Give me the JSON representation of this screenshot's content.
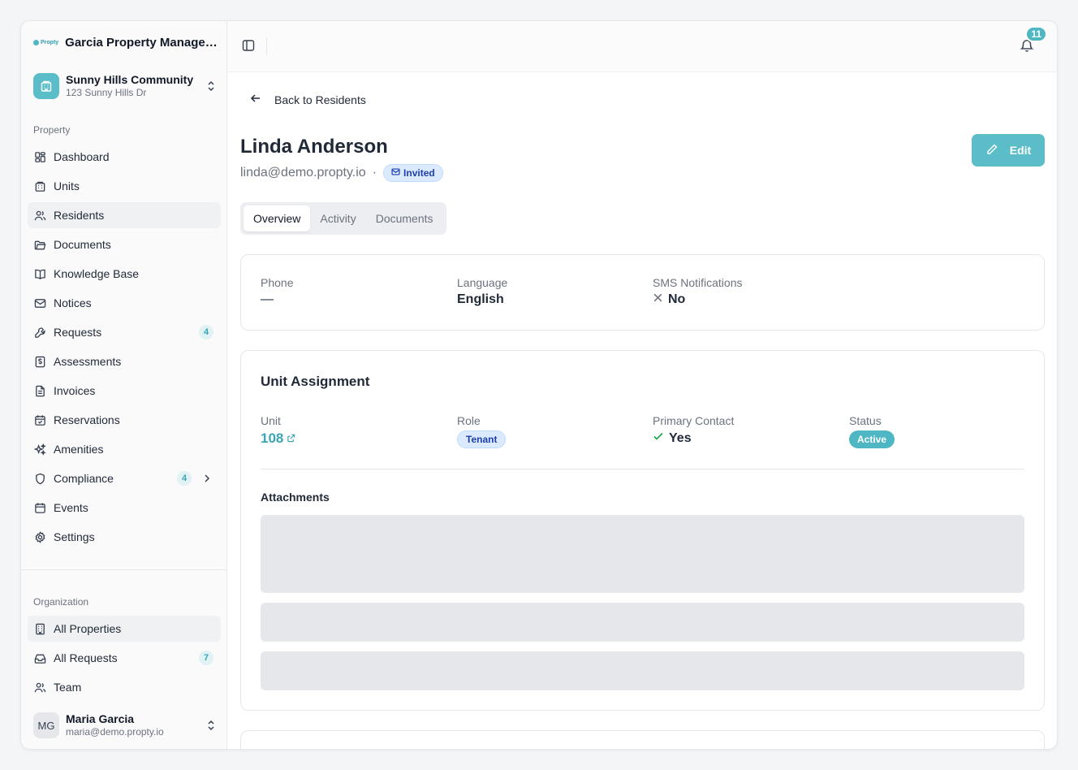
{
  "brand": {
    "logo_text": "Propty",
    "title": "Garcia Property Managem..."
  },
  "community": {
    "name": "Sunny Hills Community",
    "address": "123 Sunny Hills Dr"
  },
  "sidebar": {
    "property_label": "Property",
    "property_items": [
      {
        "label": "Dashboard",
        "icon": "dashboard-icon"
      },
      {
        "label": "Units",
        "icon": "building-icon"
      },
      {
        "label": "Residents",
        "icon": "users-icon",
        "active": true
      },
      {
        "label": "Documents",
        "icon": "folder-icon"
      },
      {
        "label": "Knowledge Base",
        "icon": "book-icon"
      },
      {
        "label": "Notices",
        "icon": "mail-icon"
      },
      {
        "label": "Requests",
        "icon": "wrench-icon",
        "badge": "4"
      },
      {
        "label": "Assessments",
        "icon": "dollar-icon"
      },
      {
        "label": "Invoices",
        "icon": "file-icon"
      },
      {
        "label": "Reservations",
        "icon": "calendar-check-icon"
      },
      {
        "label": "Amenities",
        "icon": "sparkles-icon"
      },
      {
        "label": "Compliance",
        "icon": "shield-icon",
        "badge": "4"
      },
      {
        "label": "Events",
        "icon": "calendar-icon"
      },
      {
        "label": "Settings",
        "icon": "gear-icon"
      }
    ],
    "organization_label": "Organization",
    "org_items": [
      {
        "label": "All Properties",
        "icon": "building-icon"
      },
      {
        "label": "All Requests",
        "icon": "inbox-icon",
        "badge": "7"
      },
      {
        "label": "Team",
        "icon": "users-icon"
      }
    ]
  },
  "user": {
    "initials": "MG",
    "name": "Maria Garcia",
    "email": "maria@demo.propty.io"
  },
  "topbar": {
    "notification_count": "11"
  },
  "page": {
    "back_label": "Back to Residents",
    "name": "Linda Anderson",
    "email": "linda@demo.propty.io",
    "separator": "·",
    "status_badge": "Invited",
    "edit_label": "Edit",
    "tabs": [
      "Overview",
      "Activity",
      "Documents"
    ]
  },
  "details": {
    "phone_label": "Phone",
    "phone_value": "—",
    "language_label": "Language",
    "language_value": "English",
    "sms_label": "SMS Notifications",
    "sms_value": "No"
  },
  "unit_assignment": {
    "title": "Unit Assignment",
    "unit_label": "Unit",
    "unit_value": "108",
    "role_label": "Role",
    "role_value": "Tenant",
    "primary_label": "Primary Contact",
    "primary_value": "Yes",
    "status_label": "Status",
    "status_value": "Active",
    "attachments_label": "Attachments"
  },
  "colors": {
    "accent": "#4fb6c4",
    "badge_blue_bg": "#dbeafe",
    "skeleton": "#e5e7eb"
  }
}
